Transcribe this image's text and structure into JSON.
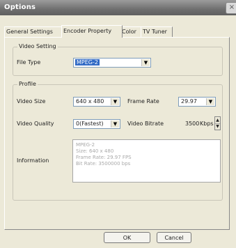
{
  "window": {
    "title": "Options",
    "close_glyph": "×"
  },
  "tabs": [
    {
      "label": "General Settings",
      "active": false
    },
    {
      "label": "Encoder Property",
      "active": true
    },
    {
      "label": "Color",
      "active": false
    },
    {
      "label": "TV Tuner",
      "active": false
    }
  ],
  "video_setting": {
    "legend": "Video Setting",
    "file_type_label": "File Type",
    "file_type_value": "MPEG-2"
  },
  "profile": {
    "legend": "Profile",
    "video_size_label": "Video Size",
    "video_size_value": "640 x 480",
    "frame_rate_label": "Frame Rate",
    "frame_rate_value": "29.97",
    "video_quality_label": "Video Quality",
    "video_quality_value": "0(Fastest)",
    "video_bitrate_label": "Video Bitrate",
    "video_bitrate_value": "3500",
    "video_bitrate_unit": "Kbps",
    "information_label": "Information",
    "information_lines": [
      "MPEG-2",
      "Size: 640 x 480",
      "Frame Rate: 29.97 FPS",
      "Bit Rate: 3500000 bps"
    ]
  },
  "buttons": {
    "ok": "OK",
    "cancel": "Cancel"
  },
  "icons": {
    "dropdown_arrow": "▼",
    "spin_up": "▲",
    "spin_down": "▼"
  }
}
